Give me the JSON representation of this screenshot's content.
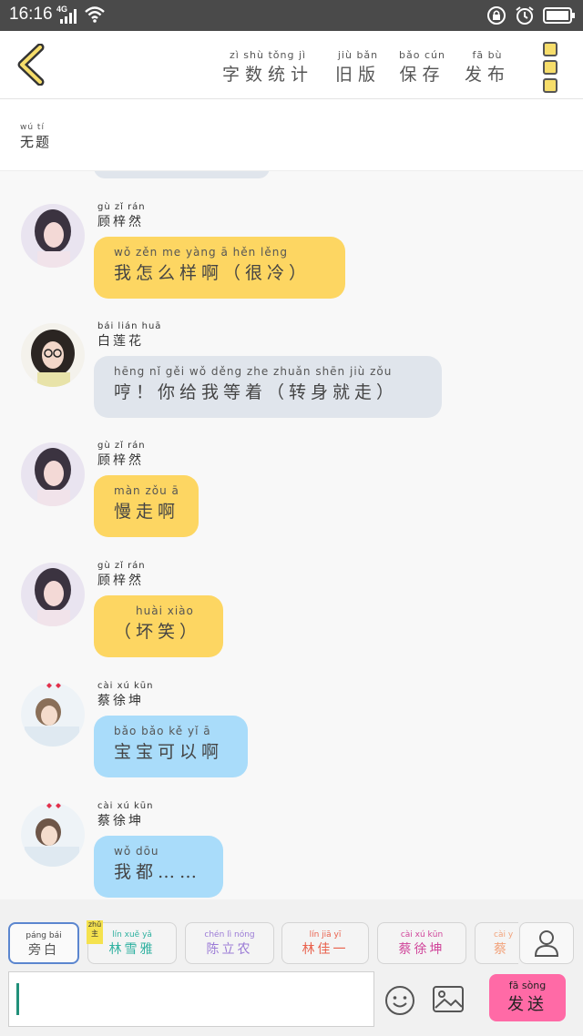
{
  "status_bar": {
    "time": "16:16",
    "network": "4G"
  },
  "header": {
    "items": [
      {
        "py": "zì  shù tǒng  jì",
        "hz": "字数统计"
      },
      {
        "py": "jiù  bǎn",
        "hz": "旧版"
      },
      {
        "py": "bǎo  cún",
        "hz": "保存"
      },
      {
        "py": "fā   bù",
        "hz": "发布"
      }
    ]
  },
  "title": {
    "py": "wú   tí",
    "hz": "无题"
  },
  "messages": [
    {
      "name_py": "gù  zǐ  rán",
      "name_hz": "顾梓然",
      "py": "wǒ  zěn  me  yàng   ā        hěn  lěng",
      "hz": "我怎么样啊（很冷）"
    },
    {
      "name_py": "bái  lián  huā",
      "name_hz": "白莲花",
      "py": "hēng        nǐ   gěi  wǒ  děng zhe      zhuǎn shēn  jiù  zǒu",
      "hz": "哼！你给我等着（转身就走）"
    },
    {
      "name_py": "gù  zǐ  rán",
      "name_hz": "顾梓然",
      "py": "màn  zǒu   ā",
      "hz": "慢走啊"
    },
    {
      "name_py": "gù  zǐ  rán",
      "name_hz": "顾梓然",
      "py": "huài  xiào",
      "hz": "（坏笑）"
    },
    {
      "name_py": "cài  xú  kūn",
      "name_hz": "蔡徐坤",
      "py": "bǎo  bǎo  kě   yǐ    ā",
      "hz": "宝宝可以啊"
    },
    {
      "name_py": "cài  xú  kūn",
      "name_hz": "蔡徐坤",
      "py": "wǒ  dōu",
      "hz": "我都……"
    }
  ],
  "characters": [
    {
      "py": "páng bái",
      "hz": "旁白"
    },
    {
      "py": "lín  xuě  yǎ",
      "hz": "林雪雅",
      "badge": "zhǔ 主"
    },
    {
      "py": "chén  lì  nóng",
      "hz": "陈立农"
    },
    {
      "py": "lín  jiā  yī",
      "hz": "林佳一"
    },
    {
      "py": "cài  xú  kūn",
      "hz": "蔡徐坤"
    },
    {
      "py": "cài  y",
      "hz": "蔡"
    }
  ],
  "composer": {
    "send_py": "fā  sòng",
    "send_hz": "发送"
  },
  "colors": {
    "yellow": "#fdd662",
    "gray_bubble": "#e0e5ec",
    "blue_bubble": "#a9dcfa",
    "send": "#ff6aa6",
    "active_chip": "#5b86cf"
  },
  "icons": [
    "back-icon",
    "menu-icon",
    "emoji-icon",
    "image-icon",
    "person-icon",
    "signal-icon",
    "wifi-icon",
    "lock-icon",
    "alarm-icon",
    "battery-icon"
  ]
}
